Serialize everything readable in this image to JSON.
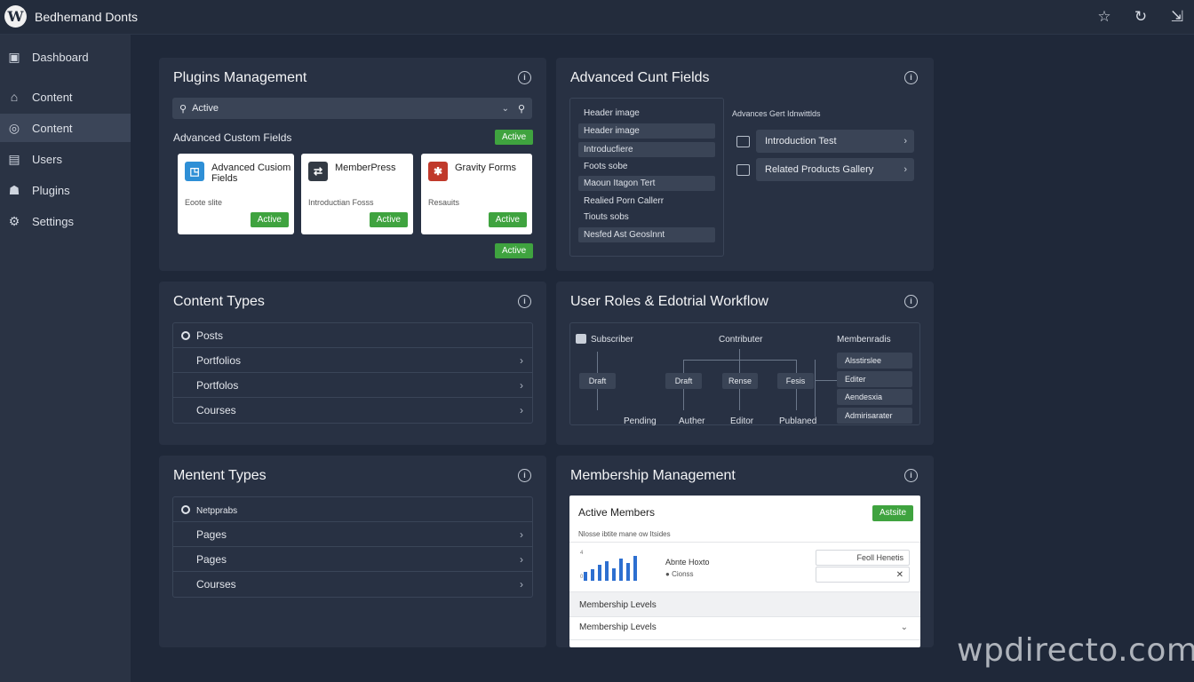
{
  "topbar": {
    "logo": "W",
    "site_title": "Bedhemand Donts",
    "icons": [
      "star-icon",
      "refresh-icon",
      "exit-icon"
    ]
  },
  "sidebar": {
    "items": [
      {
        "label": "Dashboard",
        "icon": "dashboard-icon"
      },
      {
        "label": "Content",
        "icon": "home-icon"
      },
      {
        "label": "Content",
        "icon": "content-icon",
        "active": true
      },
      {
        "label": "Users",
        "icon": "users-icon"
      },
      {
        "label": "Plugins",
        "icon": "plugins-icon"
      },
      {
        "label": "Settings",
        "icon": "gear-icon"
      }
    ]
  },
  "plugins_panel": {
    "title": "Plugins Management",
    "search_value": "Active",
    "section_label": "Advanced Custom Fields",
    "section_badge": "Active",
    "bottom_badge": "Active",
    "cards": [
      {
        "name": "Advanced Cusiom Fields",
        "desc": "Eoote slite",
        "badge": "Active",
        "logo_color": "#2e8fd6",
        "logo": "◳"
      },
      {
        "name": "MemberPress",
        "desc": "Introductian Fosss",
        "badge": "Active",
        "logo_color": "#333a44",
        "logo": "⇄"
      },
      {
        "name": "Gravity Forms",
        "desc": "Resauits",
        "badge": "Active",
        "logo_color": "#c0392b",
        "logo": "✱"
      }
    ]
  },
  "acf_panel": {
    "title": "Advanced Cunt Fields",
    "left_rows": [
      {
        "label": "Header image",
        "box": false
      },
      {
        "label": "Header image",
        "box": true
      },
      {
        "label": "Introducfiere",
        "box": true
      },
      {
        "label": "Foots sobe",
        "box": false
      },
      {
        "label": "Maoun  Itagon Tert",
        "box": true
      },
      {
        "label": "Realied Porn Callerr",
        "box": false
      },
      {
        "label": "Tiouts sobs",
        "box": false
      },
      {
        "label": "Nesfed Ast Geoslnnt",
        "box": true
      }
    ],
    "right_heading": "Advances Gert Idnwittlds",
    "right_buttons": [
      "Introduction Test",
      "Related Products Gallery"
    ]
  },
  "content_types_panel": {
    "title": "Content Types",
    "rows": [
      "Posts",
      "Portfolios",
      "Portfolos",
      "Courses"
    ]
  },
  "workflow_panel": {
    "title": "User Roles & Edotrial Workflow",
    "top_labels": [
      "Subscriber",
      "Contributer",
      "Membenradis"
    ],
    "nodes": [
      "Draft",
      "Draft",
      "Rense",
      "Fesis"
    ],
    "bottom_labels": [
      "Pending",
      "Auther",
      "Editor",
      "Publaned"
    ],
    "roles": [
      "Alsstirslee",
      "Editer",
      "Aendesxia",
      "Admirisarater"
    ]
  },
  "mentent_types_panel": {
    "title": "Mentent Types",
    "rows": [
      "Netpprabs",
      "Pages",
      "Pages",
      "Courses"
    ]
  },
  "membership_panel": {
    "title": "Membership Management",
    "card_title": "Active Members",
    "card_badge": "Astsite",
    "subtitle": "Nlosse ibtite mane ow Itsides",
    "legend_1": "Abnte Hoxto",
    "legend_2": "Cionss",
    "input_1": "Feoll Henetis",
    "input_2": "",
    "levels_heading": "Membership Levels",
    "levels_dropdown": "Membership Levels",
    "bar_values": [
      0.35,
      0.45,
      0.65,
      0.8,
      0.5,
      0.9,
      0.7,
      1.0
    ],
    "accent": "#2d6fd0"
  },
  "watermark": "wpdirecto.com"
}
